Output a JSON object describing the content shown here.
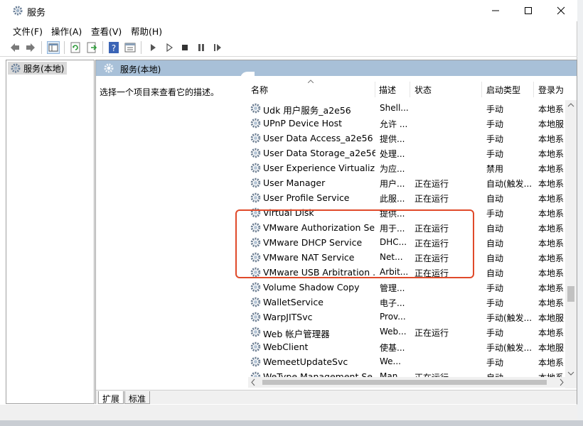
{
  "window": {
    "title": "服务"
  },
  "menu": [
    "文件(F)",
    "操作(A)",
    "查看(V)",
    "帮助(H)"
  ],
  "tree": {
    "root_label": "服务(本地)"
  },
  "panel": {
    "title": "服务(本地)",
    "description_prompt": "选择一个项目来查看它的描述。"
  },
  "columns": [
    "名称",
    "描述",
    "状态",
    "启动类型",
    "登录为"
  ],
  "services": [
    {
      "name": "Udk 用户服务_a2e56",
      "desc": "Shell...",
      "status": "",
      "startup": "手动",
      "logon": "本地系"
    },
    {
      "name": "UPnP Device Host",
      "desc": "允许 ...",
      "status": "",
      "startup": "手动",
      "logon": "本地服"
    },
    {
      "name": "User Data Access_a2e56",
      "desc": "提供...",
      "status": "",
      "startup": "手动",
      "logon": "本地系"
    },
    {
      "name": "User Data Storage_a2e56",
      "desc": "处理...",
      "status": "",
      "startup": "手动",
      "logon": "本地系"
    },
    {
      "name": "User Experience Virtualiz...",
      "desc": "为应...",
      "status": "",
      "startup": "禁用",
      "logon": "本地系"
    },
    {
      "name": "User Manager",
      "desc": "用户...",
      "status": "正在运行",
      "startup": "自动(触发...",
      "logon": "本地系"
    },
    {
      "name": "User Profile Service",
      "desc": "此服...",
      "status": "正在运行",
      "startup": "自动",
      "logon": "本地系"
    },
    {
      "name": "Virtual Disk",
      "desc": "提供...",
      "status": "",
      "startup": "手动",
      "logon": "本地系"
    },
    {
      "name": "VMware Authorization Se...",
      "desc": "用于...",
      "status": "正在运行",
      "startup": "自动",
      "logon": "本地系"
    },
    {
      "name": "VMware DHCP Service",
      "desc": "DHC...",
      "status": "正在运行",
      "startup": "自动",
      "logon": "本地系"
    },
    {
      "name": "VMware NAT Service",
      "desc": "Net...",
      "status": "正在运行",
      "startup": "自动",
      "logon": "本地系"
    },
    {
      "name": "VMware USB Arbitration ...",
      "desc": "Arbit...",
      "status": "正在运行",
      "startup": "自动",
      "logon": "本地系"
    },
    {
      "name": "Volume Shadow Copy",
      "desc": "管理...",
      "status": "",
      "startup": "手动",
      "logon": "本地系"
    },
    {
      "name": "WalletService",
      "desc": "电子...",
      "status": "",
      "startup": "手动",
      "logon": "本地系"
    },
    {
      "name": "WarpJITSvc",
      "desc": "Prov...",
      "status": "",
      "startup": "手动(触发...",
      "logon": "本地服"
    },
    {
      "name": "Web 帐户管理器",
      "desc": "Web...",
      "status": "正在运行",
      "startup": "手动",
      "logon": "本地系"
    },
    {
      "name": "WebClient",
      "desc": "使基...",
      "status": "",
      "startup": "手动(触发...",
      "logon": "本地服"
    },
    {
      "name": "WemeetUpdateSvc",
      "desc": "We...",
      "status": "",
      "startup": "手动",
      "logon": "本地系"
    },
    {
      "name": "WeType Management Se...",
      "desc": "Man...",
      "status": "正在运行",
      "startup": "自动",
      "logon": "本地系"
    }
  ],
  "tabs": [
    "扩展",
    "标准"
  ],
  "colors": {
    "highlight": "#e04a2a",
    "panel_header": "#a8c0d8"
  }
}
